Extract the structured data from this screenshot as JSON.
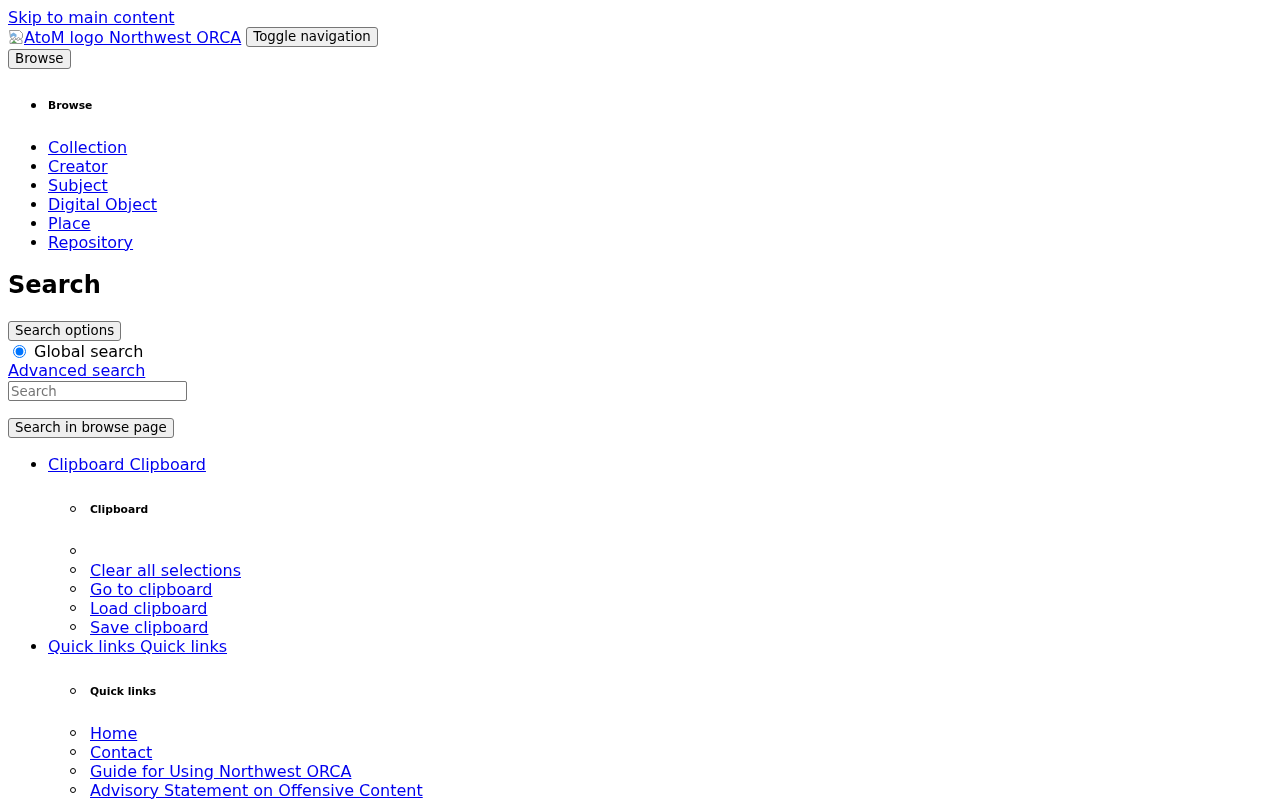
{
  "skip_link": "Skip to main content",
  "header": {
    "logo_alt": "AtoM logo",
    "site_name": "Northwest ORCA",
    "toggle_button": "Toggle navigation"
  },
  "browse_menu": {
    "button": "Browse",
    "heading": "Browse",
    "items": [
      "Collection",
      "Creator",
      "Subject",
      "Digital Object",
      "Place",
      "Repository"
    ]
  },
  "search": {
    "heading": "Search",
    "options_button": "Search options",
    "scope_options": [
      {
        "label": "Global search",
        "selected": true
      }
    ],
    "advanced_link": "Advanced search",
    "placeholder": "Search",
    "submit_button": "Search in browse page"
  },
  "menus": [
    {
      "link": "Clipboard Clipboard",
      "heading": "Clipboard",
      "blank_item": true,
      "items": [
        "Clear all selections",
        "Go to clipboard",
        "Load clipboard",
        "Save clipboard"
      ]
    },
    {
      "link": "Quick links Quick links",
      "heading": "Quick links",
      "items": [
        "Home",
        "Contact",
        "Guide for Using Northwest ORCA",
        "Advisory Statement on Offensive Content"
      ]
    }
  ]
}
